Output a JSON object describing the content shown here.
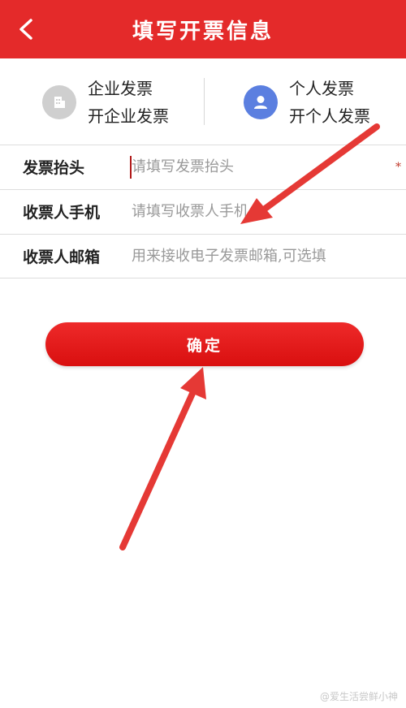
{
  "header": {
    "title": "填写开票信息",
    "back_icon": "chevron-left-icon",
    "color": "#e42a2a"
  },
  "invoice_types": [
    {
      "name": "企业发票",
      "subtitle": "开企业发票",
      "icon": "building-icon",
      "color": "#cccccc",
      "selected": false
    },
    {
      "name": "个人发票",
      "subtitle": "开个人发票",
      "icon": "person-icon",
      "color": "#5b7fe0",
      "selected": true
    }
  ],
  "form": {
    "title": {
      "label": "发票抬头",
      "placeholder": "请填写发票抬头",
      "required_mark": "*"
    },
    "phone": {
      "label": "收票人手机",
      "placeholder": "请填写收票人手机"
    },
    "email": {
      "label": "收票人邮箱",
      "placeholder": "用来接收电子发票邮箱,可选填"
    }
  },
  "confirm_button": {
    "label": "确定"
  },
  "watermark": "@爱生活尝鲜小神"
}
